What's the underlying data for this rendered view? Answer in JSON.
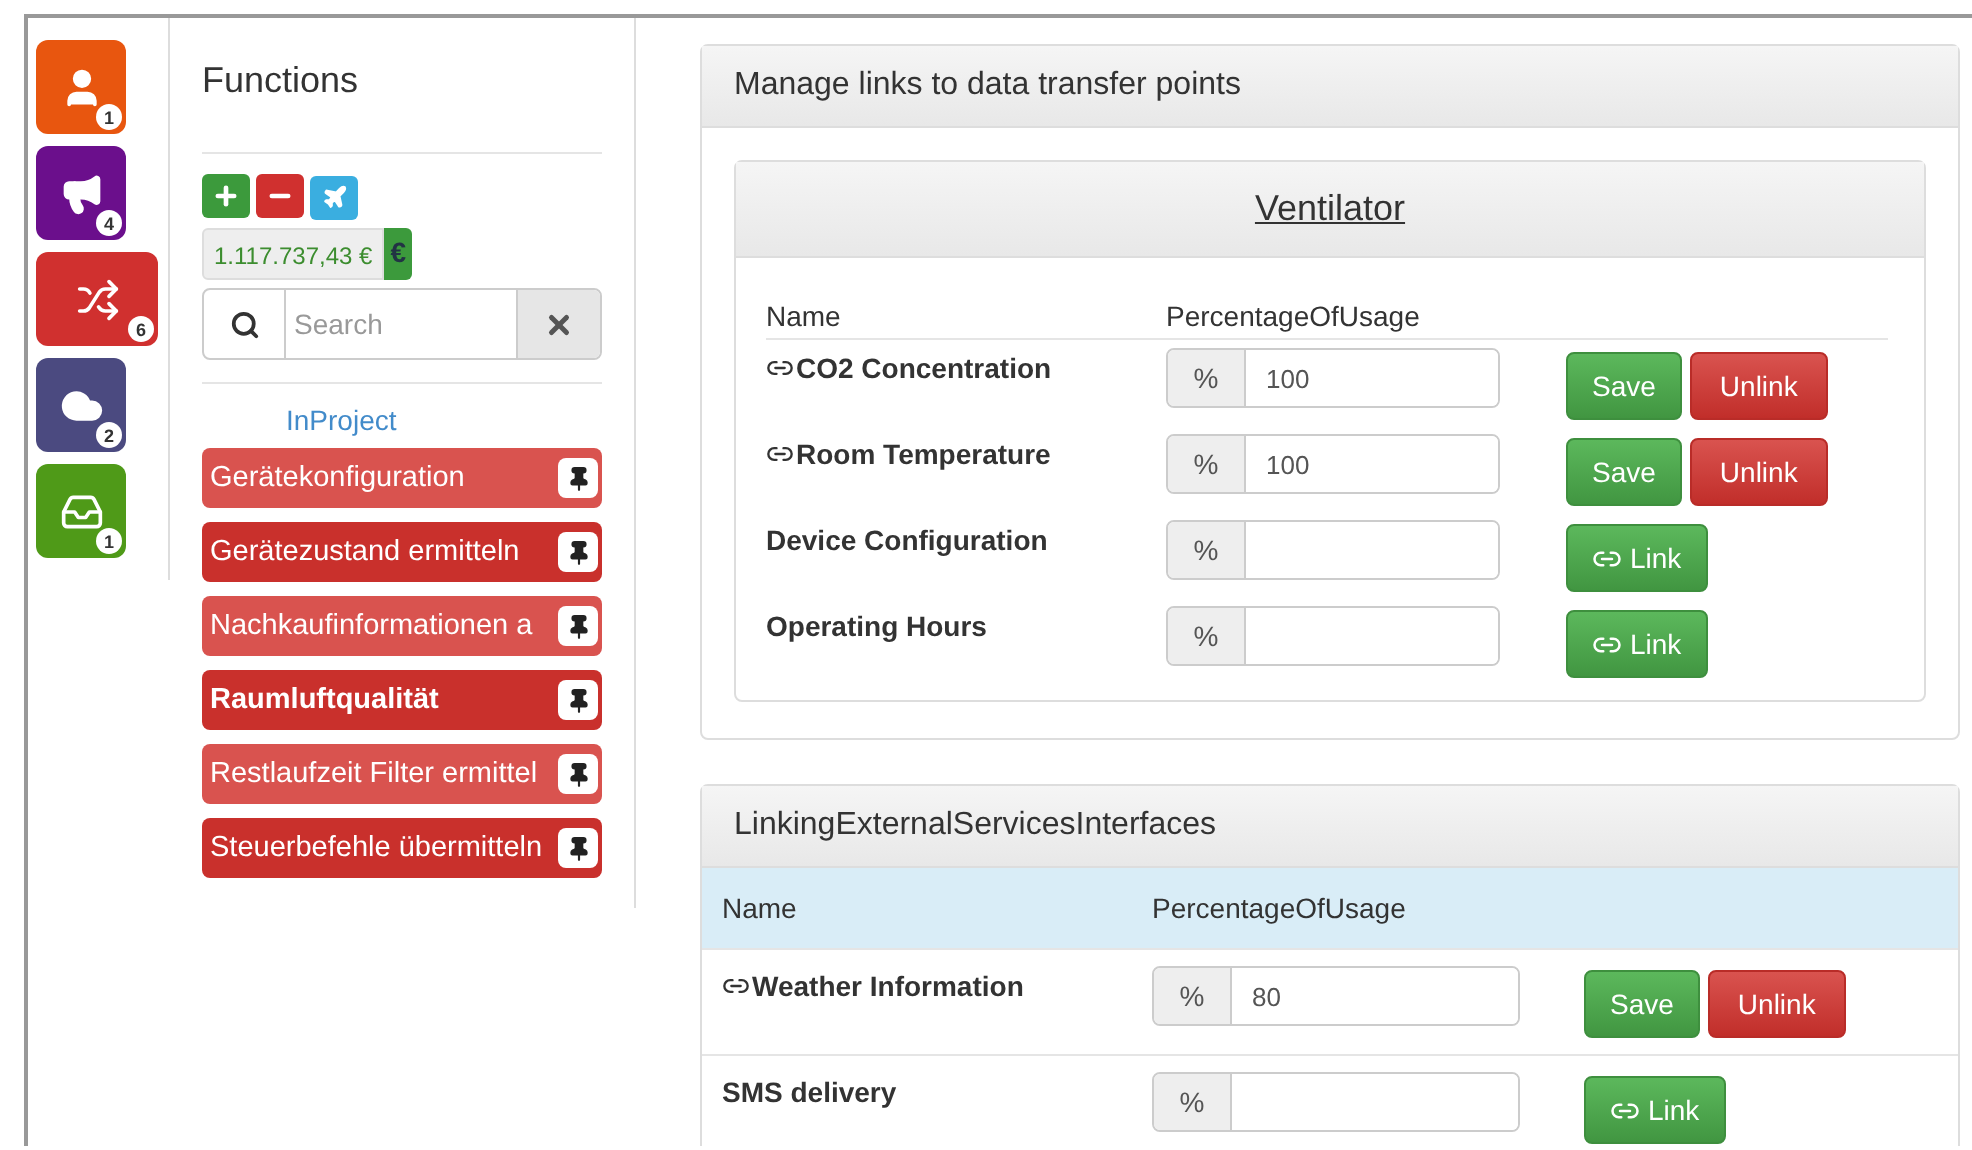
{
  "nav_tiles": [
    {
      "kind": "user",
      "badge": "1",
      "color": "#e8560f",
      "selected": false
    },
    {
      "kind": "megaphone",
      "badge": "4",
      "color": "#6b0f8c",
      "selected": false
    },
    {
      "kind": "shuffle",
      "badge": "6",
      "color": "#d0302f",
      "selected": true
    },
    {
      "kind": "cloud",
      "badge": "2",
      "color": "#4b4a80",
      "selected": false
    },
    {
      "kind": "tray",
      "badge": "1",
      "color": "#4f9a18",
      "selected": false
    }
  ],
  "functions": {
    "title": "Functions",
    "balance": "1.117.737,43 €",
    "currency": "€",
    "search": {
      "placeholder": "Search"
    },
    "group_label": "InProject",
    "items": [
      {
        "label": "Gerätekonfiguration",
        "active": false,
        "selected": false
      },
      {
        "label": "Gerätezustand ermitteln",
        "active": true,
        "selected": false
      },
      {
        "label": "Nachkaufinformationen a",
        "active": false,
        "selected": false
      },
      {
        "label": "Raumluftqualität",
        "active": true,
        "selected": true
      },
      {
        "label": "Restlaufzeit Filter ermittel",
        "active": false,
        "selected": false
      },
      {
        "label": "Steuerbefehle übermitteln",
        "active": true,
        "selected": false
      }
    ]
  },
  "links_panel": {
    "title": "Manage links to data transfer points",
    "device": "Ventilator",
    "columns": [
      "Name",
      "PercentageOfUsage"
    ],
    "rows": [
      {
        "name": "CO2 Concentration",
        "unit": "%",
        "value": "100",
        "linked": true,
        "save": "Save",
        "unlink": "Unlink"
      },
      {
        "name": "Room Temperature",
        "unit": "%",
        "value": "100",
        "linked": true,
        "save": "Save",
        "unlink": "Unlink"
      },
      {
        "name": "Device Configuration",
        "unit": "%",
        "value": "",
        "linked": false,
        "link": "Link"
      },
      {
        "name": "Operating Hours",
        "unit": "%",
        "value": "",
        "linked": false,
        "link": "Link"
      }
    ]
  },
  "services_panel": {
    "title": "LinkingExternalServicesInterfaces",
    "columns": [
      "Name",
      "PercentageOfUsage"
    ],
    "rows": [
      {
        "name": "Weather Information",
        "unit": "%",
        "value": "80",
        "linked": true,
        "save": "Save",
        "unlink": "Unlink"
      },
      {
        "name": "SMS delivery",
        "unit": "%",
        "value": "",
        "linked": false,
        "link": "Link"
      }
    ]
  }
}
